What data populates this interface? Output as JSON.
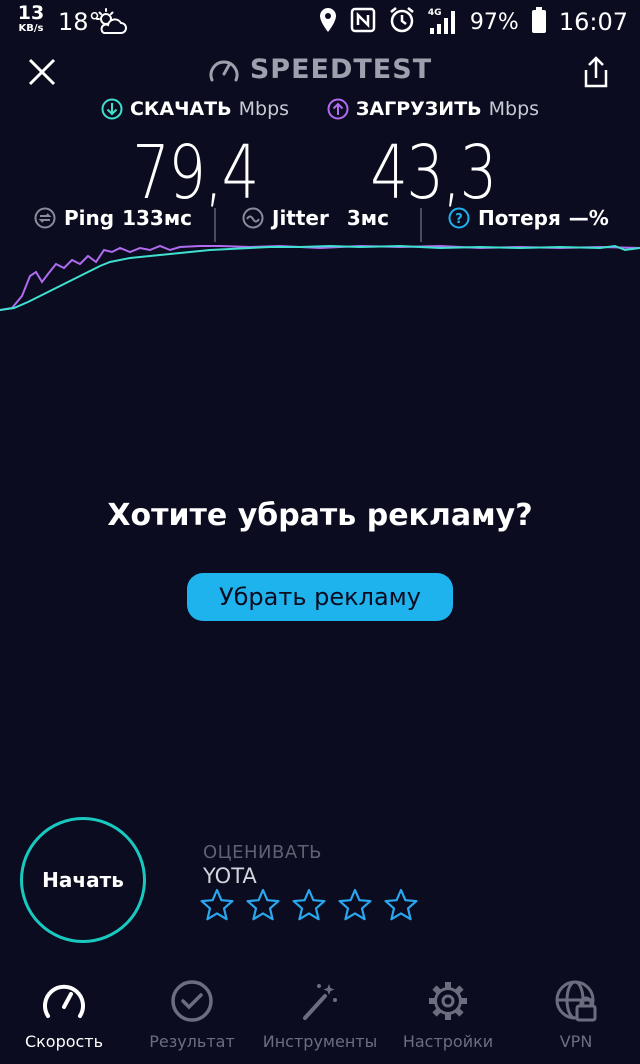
{
  "status_bar": {
    "net_speed": "13",
    "net_speed_unit": "KB/s",
    "temperature": "18°",
    "network_type": "4G",
    "battery_percent": "97%",
    "time": "16:07"
  },
  "header": {
    "title": "SPEEDTEST"
  },
  "download": {
    "label": "СКАЧАТЬ",
    "unit": "Mbps",
    "value": "79,4"
  },
  "upload": {
    "label": "ЗАГРУЗИТЬ",
    "unit": "Mbps",
    "value": "43,3"
  },
  "metrics": {
    "ping_label": "Ping",
    "ping_value": "133мс",
    "jitter_label": "Jitter",
    "jitter_value": "3мс",
    "loss_label": "Потеря",
    "loss_value": "—%"
  },
  "ad": {
    "title": "Хотите убрать рекламу?",
    "button_label": "Убрать рекламу"
  },
  "start": {
    "label": "Начать"
  },
  "rating": {
    "label": "ОЦЕНИВАТЬ",
    "provider": "YOTA",
    "stars_total": 5,
    "stars_filled": 0
  },
  "nav": {
    "items": [
      {
        "label": "Скорость",
        "icon": "speedometer-icon",
        "active": true
      },
      {
        "label": "Результат",
        "icon": "check-circle-icon",
        "active": false
      },
      {
        "label": "Инструменты",
        "icon": "magic-wand-icon",
        "active": false
      },
      {
        "label": "Настройки",
        "icon": "gear-icon",
        "active": false
      },
      {
        "label": "VPN",
        "icon": "vpn-lock-icon",
        "active": false
      }
    ]
  },
  "colors": {
    "background": "#0b0c1f",
    "download_accent": "#3fe0d0",
    "upload_accent": "#b06cf0",
    "start_ring": "#19c9c0",
    "ad_button": "#1fb3ee",
    "star": "#2aa7ef"
  }
}
